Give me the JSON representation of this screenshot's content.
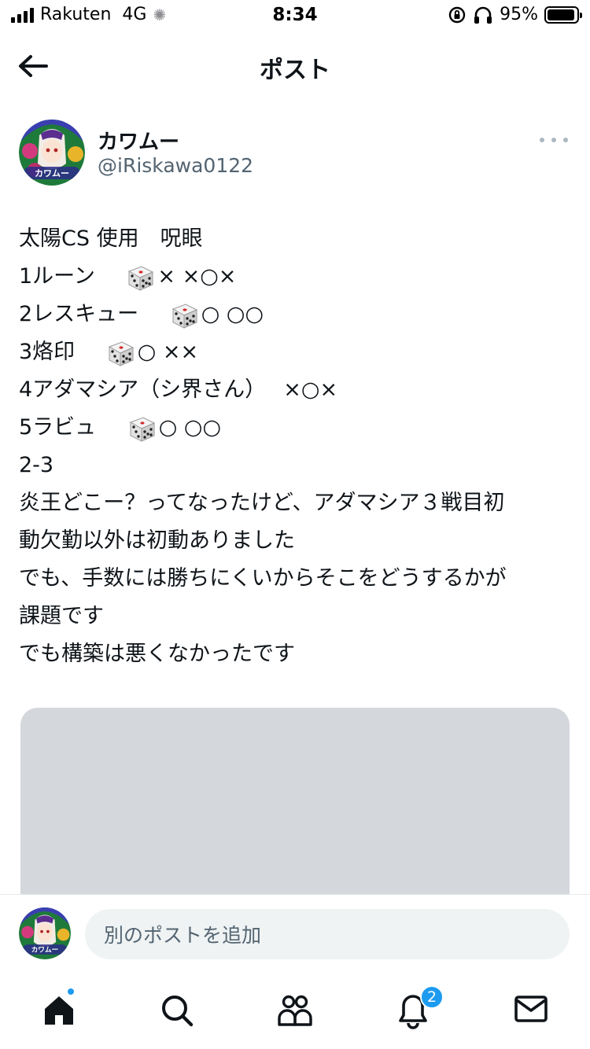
{
  "status_bar": {
    "carrier": "Rakuten",
    "network": "4G",
    "time": "8:34",
    "battery": "95%",
    "battery_level": 0.95
  },
  "header": {
    "title": "ポスト"
  },
  "author": {
    "name": "カワムー",
    "handle": "@iRiskawa0122"
  },
  "post": {
    "lines": [
      {
        "before": "太陽CS 使用　呪眼",
        "dice": false,
        "after": ""
      },
      {
        "before": "1ルーン　 ",
        "dice": true,
        "after": "× ×○×"
      },
      {
        "before": "2レスキュー　 ",
        "dice": true,
        "after": "○ ○○"
      },
      {
        "before": "3烙印　 ",
        "dice": true,
        "after": "○ ××"
      },
      {
        "before": "4アダマシア（シ界さん）　 ×○×",
        "dice": false,
        "after": ""
      },
      {
        "before": "5ラビュ　 ",
        "dice": true,
        "after": "○ ○○"
      },
      {
        "before": "2-3",
        "dice": false,
        "after": ""
      },
      {
        "before": "炎王どこー？ってなったけど、アダマシア３戦目初",
        "dice": false,
        "after": ""
      },
      {
        "before": "動欠勤以外は初動ありました",
        "dice": false,
        "after": ""
      },
      {
        "before": "でも、手数には勝ちにくいからそこをどうするかが",
        "dice": false,
        "after": ""
      },
      {
        "before": "課題です",
        "dice": false,
        "after": ""
      },
      {
        "before": "でも構築は悪くなかったです",
        "dice": false,
        "after": ""
      }
    ]
  },
  "reply": {
    "placeholder": "別のポストを追加"
  },
  "tabs": {
    "notifications_badge": "2"
  },
  "colors": {
    "accent": "#1d9bf0",
    "handle": "#536471",
    "media_placeholder": "#d4d8dc",
    "input_bg": "#eff3f4"
  }
}
